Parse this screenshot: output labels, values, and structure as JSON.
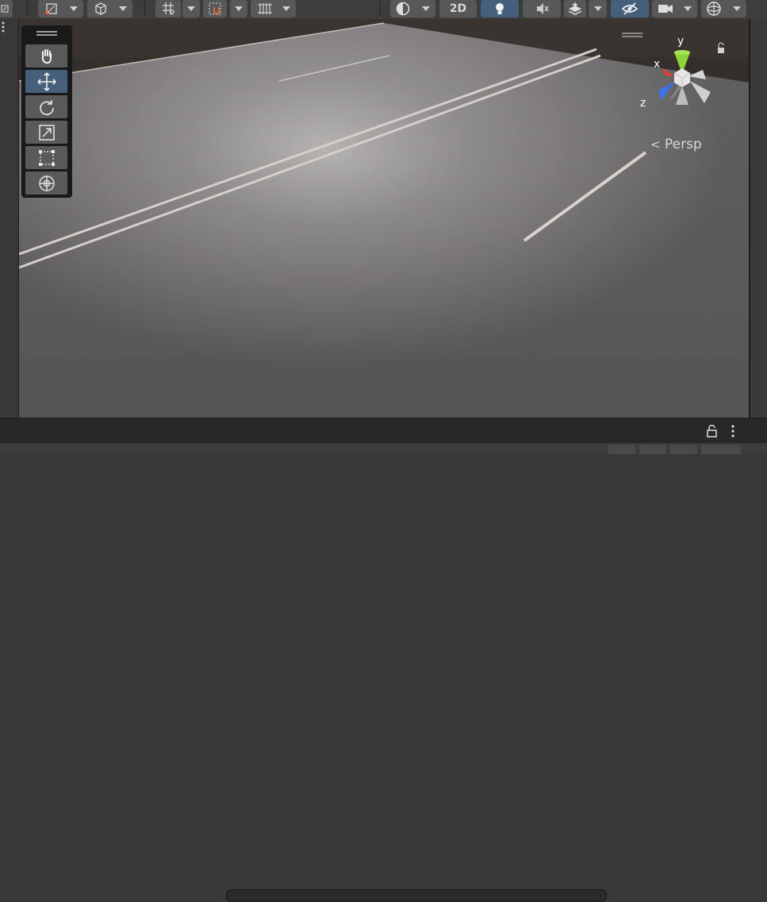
{
  "toolbar": {
    "btn_2d_label": "2D",
    "items": [
      "transform-handle-position",
      "transform-handle-rotation",
      "grid-snapping",
      "increment-snap",
      "snap-toggle",
      "draw-mode",
      "2d-toggle",
      "scene-lighting",
      "audio-toggle",
      "effects",
      "scene-visibility",
      "camera",
      "gizmos"
    ]
  },
  "tools": [
    "View Tool",
    "Move Tool",
    "Rotate Tool",
    "Scale Tool",
    "Rect Tool",
    "Transform Tool"
  ],
  "gizmo": {
    "x_label": "x",
    "y_label": "y",
    "z_label": "z",
    "projection_label": "Persp",
    "colors": {
      "x": "#e0402f",
      "y": "#8fd23a",
      "z": "#3c72e8"
    }
  },
  "colors": {
    "accent": "#46607c",
    "button": "#585858",
    "toolbar": "#3c3c3c",
    "road": "#6e6a6c"
  }
}
